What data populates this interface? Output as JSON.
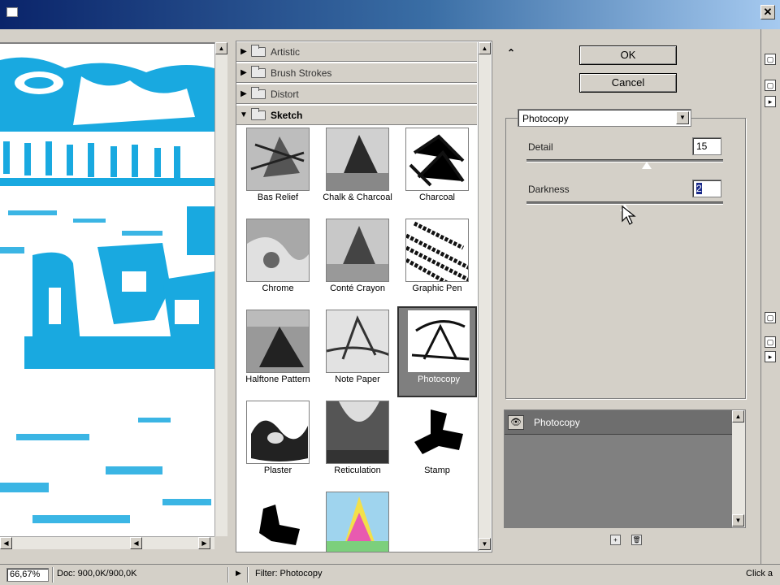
{
  "window": {
    "title": "Photocopy"
  },
  "preview": {
    "zoom": "66,67%"
  },
  "categories": [
    {
      "label": "Artistic",
      "expanded": false
    },
    {
      "label": "Brush Strokes",
      "expanded": false
    },
    {
      "label": "Distort",
      "expanded": false
    },
    {
      "label": "Sketch",
      "expanded": true
    }
  ],
  "filters": [
    {
      "label": "Bas Relief"
    },
    {
      "label": "Chalk & Charcoal"
    },
    {
      "label": "Charcoal"
    },
    {
      "label": "Chrome"
    },
    {
      "label": "Conté Crayon"
    },
    {
      "label": "Graphic Pen"
    },
    {
      "label": "Halftone Pattern"
    },
    {
      "label": "Note Paper"
    },
    {
      "label": "Photocopy",
      "selected": true
    },
    {
      "label": "Plaster"
    },
    {
      "label": "Reticulation"
    },
    {
      "label": "Stamp"
    },
    {
      "label": ""
    },
    {
      "label": ""
    }
  ],
  "buttons": {
    "ok": "OK",
    "cancel": "Cancel"
  },
  "settings": {
    "filter_select": "Photocopy",
    "detail": {
      "label": "Detail",
      "value": "15",
      "level": 0.61
    },
    "darkness": {
      "label": "Darkness",
      "value": "2",
      "level": 0.05
    }
  },
  "effect_layers": [
    {
      "name": "Photocopy"
    }
  ],
  "status": {
    "zoom": "66,67%",
    "doc": "Doc: 900,0K/900,0K",
    "filter": "Filter: Photocopy",
    "hint": "Click a"
  },
  "colors": {
    "preview_cyan": "#19a9e0",
    "selected_bg": "#7f7f7f",
    "title_gradient_start": "#0a246a"
  }
}
